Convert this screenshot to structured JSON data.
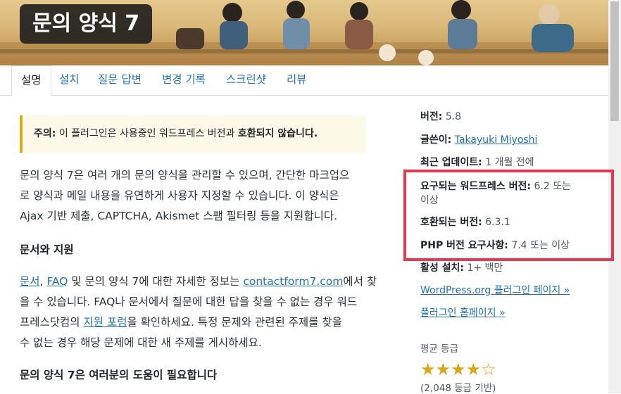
{
  "plugin": {
    "title": "문의 양식 7"
  },
  "tabs": [
    {
      "label": "설명"
    },
    {
      "label": "설치"
    },
    {
      "label": "질문 답변"
    },
    {
      "label": "변경 기록"
    },
    {
      "label": "스크린샷"
    },
    {
      "label": "리뷰"
    }
  ],
  "notice": {
    "prefix": "주의:",
    "text": "이 플러그인은 사용중인 워드프레스 버전과",
    "strong": "호환되지 않습니다."
  },
  "description": {
    "intro_lines": [
      "문의 양식 7은 여러 개의 문의 양식을 관리할 수 있으며, 간단한 마크업으",
      "로 양식과 메일 내용을 유연하게 사용자 지정할 수 있습니다. 이 양식은",
      "Ajax 기반 제출, CAPTCHA, Akismet 스팸 필터링 등을 지원합니다."
    ],
    "heading1": "문서와 지원",
    "docs": {
      "link1": "문서",
      "sep": ", ",
      "link2": "FAQ",
      "text1": " 및 문의 양식 7에 대한 자세한 정보는 ",
      "link3": "contactform7.com",
      "text2": "에서 찾",
      "line2": "을 수 있습니다. FAQ나 문서에서 질문에 대한 답을 찾을 수 없는 경우 워드",
      "line3_pre": "프레스닷컴의 ",
      "link4": "지원 포럼",
      "line3_post": "을 확인하세요. 특정 문제와 관련된 주제를 찾을",
      "line4": "수 없는 경우 해당 문제에 대한 새 주제를 게시하세요."
    },
    "heading2": "문의 양식 7은 여러분의 도움이 필요합니다"
  },
  "sidebar": {
    "version_label": "버전:",
    "version_value": "5.8",
    "author_label": "글쓴이:",
    "author_value": "Takayuki Miyoshi",
    "updated_label": "최근 업데이트:",
    "updated_value": "1 개월 전에",
    "requires_label": "요구되는 워드프레스 버전:",
    "requires_value": "6.2 또는",
    "requires_value2": "이상",
    "tested_label": "호환되는 버전:",
    "tested_value": "6.3.1",
    "php_label": "PHP 버전 요구사항:",
    "php_value": "7.4 또는 이상",
    "installs_label": "활성 설치:",
    "installs_value": "1+ 백만",
    "wporg_link": "WordPress.org 플러그인 페이지 »",
    "homepage_link": "플러그인 홈페이지 »",
    "rating_heading": "평균 등급",
    "rating": 4,
    "rating_max": 5,
    "stars_glyphs": "★★★★☆",
    "rating_count": "(2,048 등급 기반)"
  },
  "colors": {
    "link": "#2271b1",
    "highlight": "#e8384f",
    "star": "#dba617",
    "notice_border": "#dba617"
  }
}
